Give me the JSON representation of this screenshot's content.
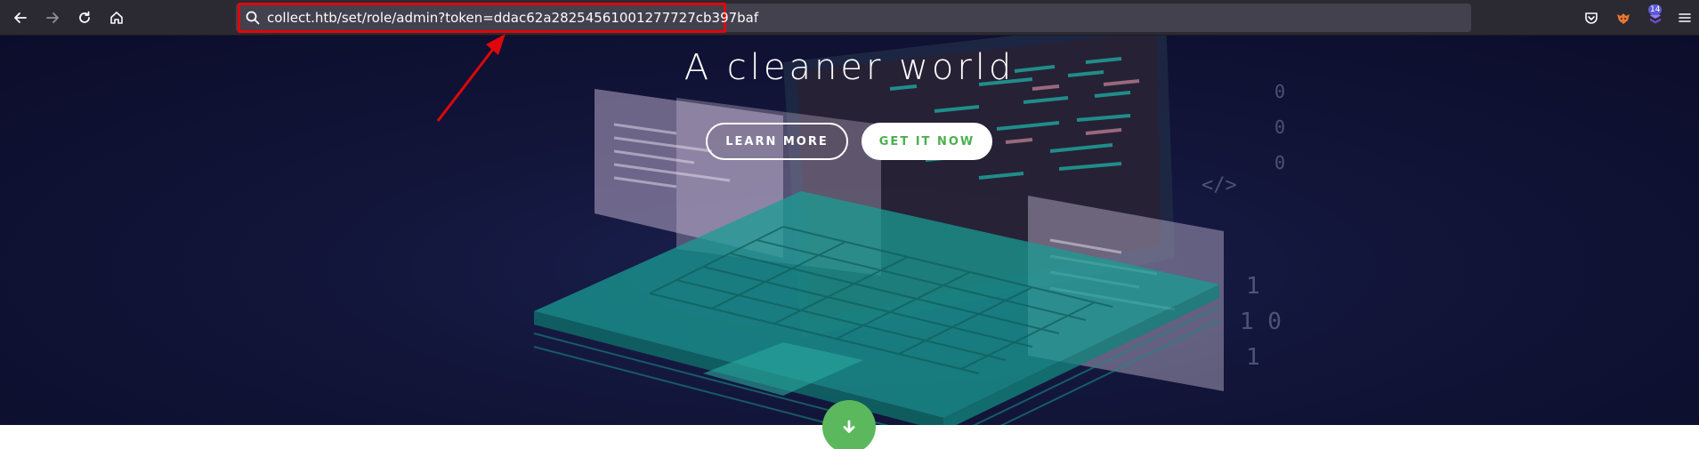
{
  "browser": {
    "url": "collect.htb/set/role/admin?token=ddac62a28254561001277727cb397baf",
    "extension_badge_count": "14",
    "icons": {
      "back": "back-arrow-icon",
      "forward": "forward-arrow-icon",
      "reload": "reload-icon",
      "home": "home-icon",
      "search": "search-icon",
      "pocket": "pocket-icon",
      "extension_fox": "fox-extension-icon",
      "extension_purple": "purple-extension-icon",
      "menu": "hamburger-menu-icon"
    }
  },
  "hero": {
    "title": "A cleaner world",
    "learn_more_label": "LEARN MORE",
    "get_it_now_label": "GET IT NOW",
    "scroll_icon": "arrow-down-icon"
  },
  "annotation": {
    "highlight_color": "#e0060b"
  },
  "colors": {
    "accent_green": "#5cb85c",
    "toolbar_bg": "#2b2a33",
    "hero_bg": "#121539"
  }
}
